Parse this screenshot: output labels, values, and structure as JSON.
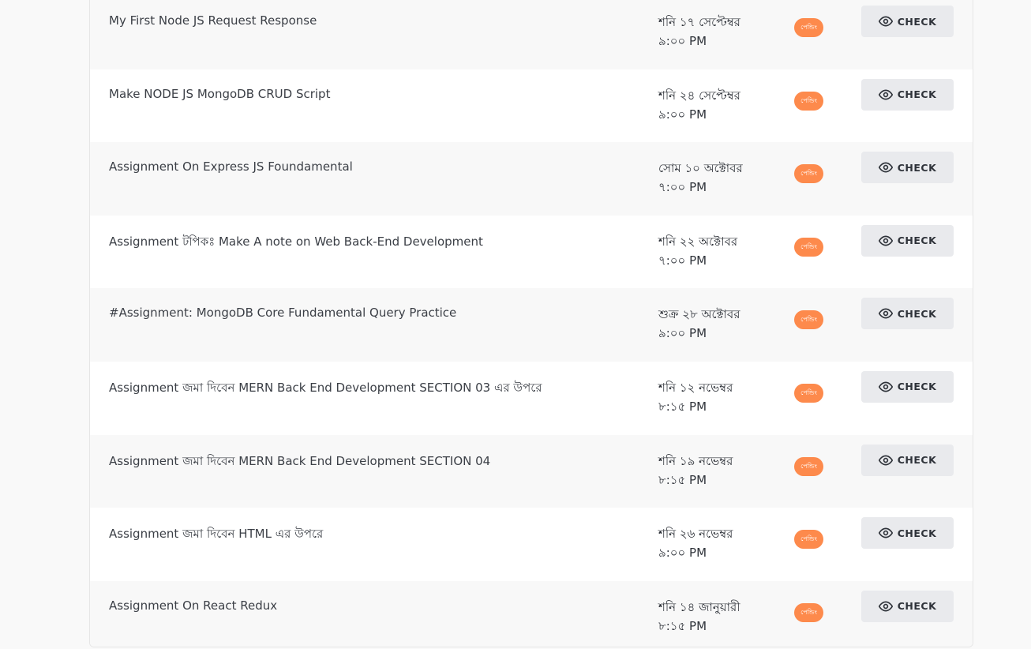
{
  "rows": [
    {
      "title": "My First Node JS Request Response",
      "date": "শনি ১৭ সেপ্টেম্বর",
      "time": "৯:০০ PM",
      "status": "পেন্ডিং",
      "action": "CHECK"
    },
    {
      "title": "Make NODE JS MongoDB CRUD Script",
      "date": "শনি ২৪ সেপ্টেম্বর",
      "time": "৯:০০ PM",
      "status": "পেন্ডিং",
      "action": "CHECK"
    },
    {
      "title": "Assignment On Express JS Foundamental",
      "date": "সোম ১০ অক্টোবর",
      "time": "৭:০০ PM",
      "status": "পেন্ডিং",
      "action": "CHECK"
    },
    {
      "title": "Assignment টপিকঃ Make A note on Web Back-End Development",
      "date": "শনি ২২ অক্টোবর",
      "time": "৭:০০ PM",
      "status": "পেন্ডিং",
      "action": "CHECK"
    },
    {
      "title": "#Assignment: MongoDB Core Fundamental Query Practice",
      "date": "শুক্র ২৮ অক্টোবর",
      "time": "৯:০০ PM",
      "status": "পেন্ডিং",
      "action": "CHECK"
    },
    {
      "title": "Assignment জমা দিবেন MERN Back End Development SECTION 03 এর উপরে",
      "date": "শনি ১২ নভেম্বর",
      "time": "৮:১৫ PM",
      "status": "পেন্ডিং",
      "action": "CHECK"
    },
    {
      "title": "Assignment জমা দিবেন MERN Back End Development SECTION 04",
      "date": "শনি ১৯ নভেম্বর",
      "time": "৮:১৫ PM",
      "status": "পেন্ডিং",
      "action": "CHECK"
    },
    {
      "title": "Assignment জমা দিবেন HTML এর উপরে",
      "date": "শনি ২৬ নভেম্বর",
      "time": "৯:০০ PM",
      "status": "পেন্ডিং",
      "action": "CHECK"
    },
    {
      "title": "Assignment On React Redux",
      "date": "শনি ১৪ জানুয়ারী",
      "time": "৮:১৫ PM",
      "status": "পেন্ডিং",
      "action": "CHECK"
    }
  ],
  "icons": {
    "check_button_icon": "eye-icon"
  },
  "colors": {
    "badge": "#fd8a4c",
    "button_bg": "#e9eaed",
    "text": "#3b3f46"
  }
}
